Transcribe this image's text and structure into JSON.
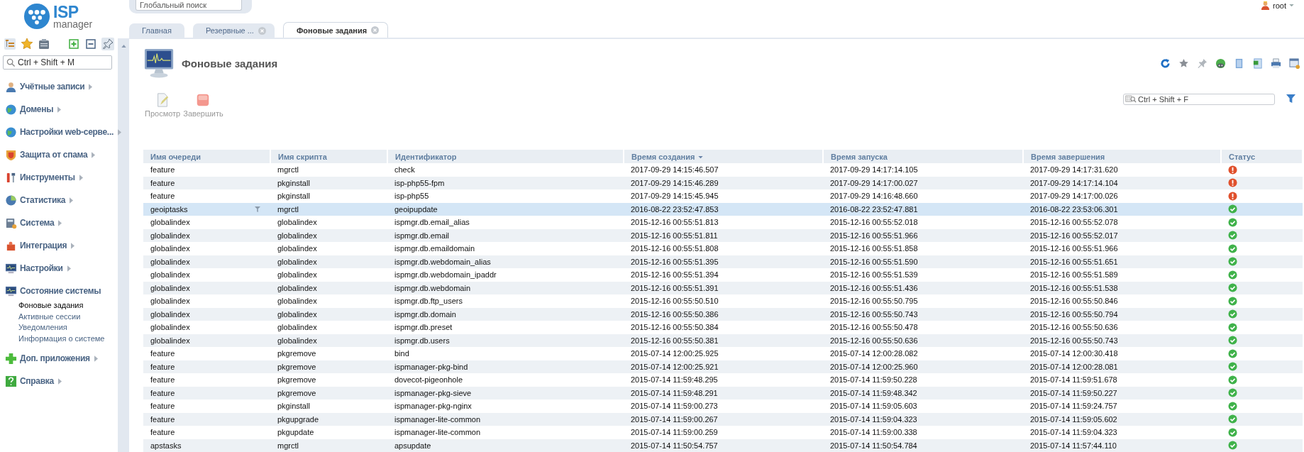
{
  "logo": {
    "brand": "ISP",
    "product": "manager"
  },
  "sidebar": {
    "search": {
      "placeholder": "Ctrl + Shift + M"
    },
    "items": [
      {
        "label": "Учётные записи",
        "expanded": false
      },
      {
        "label": "Домены",
        "expanded": false
      },
      {
        "label": "Настройки web-серве...",
        "expanded": false
      },
      {
        "label": "Защита от спама",
        "expanded": false
      },
      {
        "label": "Инструменты",
        "expanded": false
      },
      {
        "label": "Статистика",
        "expanded": false
      },
      {
        "label": "Система",
        "expanded": false
      },
      {
        "label": "Интеграция",
        "expanded": false
      },
      {
        "label": "Настройки",
        "expanded": false
      },
      {
        "label": "Состояние системы",
        "expanded": true,
        "children": [
          {
            "label": "Фоновые задания",
            "selected": true
          },
          {
            "label": "Активные сессии",
            "selected": false
          },
          {
            "label": "Уведомления",
            "selected": false
          },
          {
            "label": "Информация о системе",
            "selected": false
          }
        ]
      },
      {
        "label": "Доп. приложения",
        "expanded": false
      },
      {
        "label": "Справка",
        "expanded": false
      }
    ]
  },
  "global_search": {
    "placeholder": "Глобальный поиск"
  },
  "user": {
    "name": "root"
  },
  "tabs": [
    {
      "label": "Главная",
      "selected": false,
      "closable": false
    },
    {
      "label": "Резервные ...",
      "selected": false,
      "closable": true
    },
    {
      "label": "Фоновые задания",
      "selected": true,
      "closable": true
    }
  ],
  "page": {
    "title": "Фоновые задания",
    "toolbar": [
      {
        "label": "Просмотр",
        "kind": "view",
        "disabled": true
      },
      {
        "label": "Завершить",
        "kind": "stop",
        "disabled": true
      }
    ],
    "filter": {
      "placeholder": "Ctrl + Shift + F"
    }
  },
  "table": {
    "columns": [
      {
        "label": "Имя очереди",
        "sorted": false
      },
      {
        "label": "Имя скрипта",
        "sorted": false
      },
      {
        "label": "Идентификатор",
        "sorted": false
      },
      {
        "label": "Время создания",
        "sorted": true
      },
      {
        "label": "Время запуска",
        "sorted": false
      },
      {
        "label": "Время завершения",
        "sorted": false
      },
      {
        "label": "Статус",
        "sorted": false
      }
    ],
    "rows": [
      {
        "cells": [
          "feature",
          "mgrctl",
          "check",
          "2017-09-29 14:15:46.507",
          "2017-09-29 14:17:14.105",
          "2017-09-29 14:17:31.620"
        ],
        "kind": "error",
        "selected": false
      },
      {
        "cells": [
          "feature",
          "pkginstall",
          "isp-php55-fpm",
          "2017-09-29 14:15:46.289",
          "2017-09-29 14:17:00.027",
          "2017-09-29 14:17:14.104"
        ],
        "kind": "error",
        "selected": false
      },
      {
        "cells": [
          "feature",
          "pkginstall",
          "isp-php55",
          "2017-09-29 14:15:45.945",
          "2017-09-29 14:16:48.660",
          "2017-09-29 14:17:00.026"
        ],
        "kind": "error",
        "selected": false
      },
      {
        "cells": [
          "geoiptasks",
          "mgrctl",
          "geoipupdate",
          "2016-08-22 23:52:47.853",
          "2016-08-22 23:52:47.881",
          "2016-08-22 23:53:06.301"
        ],
        "kind": "ok",
        "selected": true
      },
      {
        "cells": [
          "globalindex",
          "globalindex",
          "ispmgr.db.email_alias",
          "2015-12-16 00:55:51.813",
          "2015-12-16 00:55:52.018",
          "2015-12-16 00:55:52.078"
        ],
        "kind": "ok",
        "selected": false
      },
      {
        "cells": [
          "globalindex",
          "globalindex",
          "ispmgr.db.email",
          "2015-12-16 00:55:51.811",
          "2015-12-16 00:55:51.966",
          "2015-12-16 00:55:52.017"
        ],
        "kind": "ok",
        "selected": false
      },
      {
        "cells": [
          "globalindex",
          "globalindex",
          "ispmgr.db.emaildomain",
          "2015-12-16 00:55:51.808",
          "2015-12-16 00:55:51.858",
          "2015-12-16 00:55:51.966"
        ],
        "kind": "ok",
        "selected": false
      },
      {
        "cells": [
          "globalindex",
          "globalindex",
          "ispmgr.db.webdomain_alias",
          "2015-12-16 00:55:51.395",
          "2015-12-16 00:55:51.590",
          "2015-12-16 00:55:51.651"
        ],
        "kind": "ok",
        "selected": false
      },
      {
        "cells": [
          "globalindex",
          "globalindex",
          "ispmgr.db.webdomain_ipaddr",
          "2015-12-16 00:55:51.394",
          "2015-12-16 00:55:51.539",
          "2015-12-16 00:55:51.589"
        ],
        "kind": "ok",
        "selected": false
      },
      {
        "cells": [
          "globalindex",
          "globalindex",
          "ispmgr.db.webdomain",
          "2015-12-16 00:55:51.391",
          "2015-12-16 00:55:51.436",
          "2015-12-16 00:55:51.538"
        ],
        "kind": "ok",
        "selected": false
      },
      {
        "cells": [
          "globalindex",
          "globalindex",
          "ispmgr.db.ftp_users",
          "2015-12-16 00:55:50.510",
          "2015-12-16 00:55:50.795",
          "2015-12-16 00:55:50.846"
        ],
        "kind": "ok",
        "selected": false
      },
      {
        "cells": [
          "globalindex",
          "globalindex",
          "ispmgr.db.domain",
          "2015-12-16 00:55:50.386",
          "2015-12-16 00:55:50.743",
          "2015-12-16 00:55:50.794"
        ],
        "kind": "ok",
        "selected": false
      },
      {
        "cells": [
          "globalindex",
          "globalindex",
          "ispmgr.db.preset",
          "2015-12-16 00:55:50.384",
          "2015-12-16 00:55:50.478",
          "2015-12-16 00:55:50.636"
        ],
        "kind": "ok",
        "selected": false
      },
      {
        "cells": [
          "globalindex",
          "globalindex",
          "ispmgr.db.users",
          "2015-12-16 00:55:50.381",
          "2015-12-16 00:55:50.636",
          "2015-12-16 00:55:50.743"
        ],
        "kind": "ok",
        "selected": false
      },
      {
        "cells": [
          "feature",
          "pkgremove",
          "bind",
          "2015-07-14 12:00:25.925",
          "2015-07-14 12:00:28.082",
          "2015-07-14 12:00:30.418"
        ],
        "kind": "ok",
        "selected": false
      },
      {
        "cells": [
          "feature",
          "pkgremove",
          "ispmanager-pkg-bind",
          "2015-07-14 12:00:25.921",
          "2015-07-14 12:00:25.960",
          "2015-07-14 12:00:28.081"
        ],
        "kind": "ok",
        "selected": false
      },
      {
        "cells": [
          "feature",
          "pkgremove",
          "dovecot-pigeonhole",
          "2015-07-14 11:59:48.295",
          "2015-07-14 11:59:50.228",
          "2015-07-14 11:59:51.678"
        ],
        "kind": "ok",
        "selected": false
      },
      {
        "cells": [
          "feature",
          "pkgremove",
          "ispmanager-pkg-sieve",
          "2015-07-14 11:59:48.291",
          "2015-07-14 11:59:48.342",
          "2015-07-14 11:59:50.227"
        ],
        "kind": "ok",
        "selected": false
      },
      {
        "cells": [
          "feature",
          "pkginstall",
          "ispmanager-pkg-nginx",
          "2015-07-14 11:59:00.273",
          "2015-07-14 11:59:05.603",
          "2015-07-14 11:59:24.757"
        ],
        "kind": "ok",
        "selected": false
      },
      {
        "cells": [
          "feature",
          "pkgupgrade",
          "ispmanager-lite-common",
          "2015-07-14 11:59:00.267",
          "2015-07-14 11:59:04.323",
          "2015-07-14 11:59:05.602"
        ],
        "kind": "ok",
        "selected": false
      },
      {
        "cells": [
          "feature",
          "pkgupdate",
          "ispmanager-lite-common",
          "2015-07-14 11:59:00.259",
          "2015-07-14 11:59:00.338",
          "2015-07-14 11:59:04.323"
        ],
        "kind": "ok",
        "selected": false
      },
      {
        "cells": [
          "apstasks",
          "mgrctl",
          "apsupdate",
          "2015-07-14 11:50:54.757",
          "2015-07-14 11:50:54.784",
          "2015-07-14 11:57:44.110"
        ],
        "kind": "ok",
        "selected": false
      }
    ]
  }
}
